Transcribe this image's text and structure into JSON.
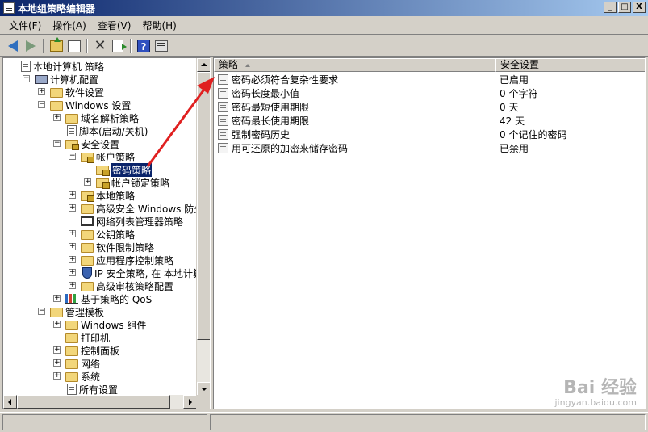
{
  "window": {
    "title": "本地组策略编辑器"
  },
  "titlebar_buttons": [
    "_",
    "□",
    "X"
  ],
  "menu": [
    "文件(F)",
    "操作(A)",
    "查看(V)",
    "帮助(H)"
  ],
  "toolbar": [
    "back-icon",
    "forward-icon",
    "up-folder-icon",
    "show-tree-icon",
    "delete-icon",
    "export-icon",
    "help-icon",
    "properties-icon"
  ],
  "tree": {
    "items": [
      {
        "label": "本地计算机 策略",
        "icon": "doc",
        "expander": ""
      },
      {
        "label": "计算机配置",
        "icon": "computer",
        "expander": "−"
      },
      {
        "label": "软件设置",
        "icon": "folder",
        "expander": "+"
      },
      {
        "label": "Windows 设置",
        "icon": "folder",
        "expander": "−"
      },
      {
        "label": "域名解析策略",
        "icon": "folder",
        "expander": "+"
      },
      {
        "label": "脚本(启动/关机)",
        "icon": "doc",
        "expander": ""
      },
      {
        "label": "安全设置",
        "icon": "folder-lock",
        "expander": "−"
      },
      {
        "label": "帐户策略",
        "icon": "folder-lock",
        "expander": "−"
      },
      {
        "label": "密码策略",
        "icon": "folder-lock",
        "expander": "",
        "selected": true
      },
      {
        "label": "帐户锁定策略",
        "icon": "folder-lock",
        "expander": "+"
      },
      {
        "label": "本地策略",
        "icon": "folder-lock",
        "expander": "+"
      },
      {
        "label": "高级安全 Windows 防火墙",
        "icon": "folder",
        "expander": "+"
      },
      {
        "label": "网络列表管理器策略",
        "icon": "netlist",
        "expander": ""
      },
      {
        "label": "公钥策略",
        "icon": "folder",
        "expander": "+"
      },
      {
        "label": "软件限制策略",
        "icon": "folder",
        "expander": "+"
      },
      {
        "label": "应用程序控制策略",
        "icon": "folder",
        "expander": "+"
      },
      {
        "label": "IP 安全策略, 在 本地计算",
        "icon": "shield",
        "expander": "+"
      },
      {
        "label": "高级审核策略配置",
        "icon": "folder",
        "expander": "+"
      },
      {
        "label": "基于策略的 QoS",
        "icon": "chart",
        "expander": "+"
      },
      {
        "label": "管理模板",
        "icon": "folder",
        "expander": "−"
      },
      {
        "label": "Windows 组件",
        "icon": "folder",
        "expander": "+"
      },
      {
        "label": "打印机",
        "icon": "folder",
        "expander": ""
      },
      {
        "label": "控制面板",
        "icon": "folder",
        "expander": "+"
      },
      {
        "label": "网络",
        "icon": "folder",
        "expander": "+"
      },
      {
        "label": "系统",
        "icon": "folder",
        "expander": "+"
      },
      {
        "label": "所有设置",
        "icon": "doc",
        "expander": ""
      }
    ]
  },
  "list": {
    "columns": [
      "策略",
      "安全设置"
    ],
    "rows": [
      {
        "policy": "密码必须符合复杂性要求",
        "setting": "已启用"
      },
      {
        "policy": "密码长度最小值",
        "setting": "0 个字符"
      },
      {
        "policy": "密码最短使用期限",
        "setting": "0 天"
      },
      {
        "policy": "密码最长使用期限",
        "setting": "42 天"
      },
      {
        "policy": "强制密码历史",
        "setting": "0 个记住的密码"
      },
      {
        "policy": "用可还原的加密来储存密码",
        "setting": "已禁用"
      }
    ]
  },
  "watermark": {
    "brand": "Bai 经验",
    "url": "jingyan.baidu.com"
  },
  "colors": {
    "titlebar": "#0a246a",
    "selection": "#0a246a",
    "annotation_arrow": "#e02020",
    "window_bg": "#d4d0c8"
  }
}
